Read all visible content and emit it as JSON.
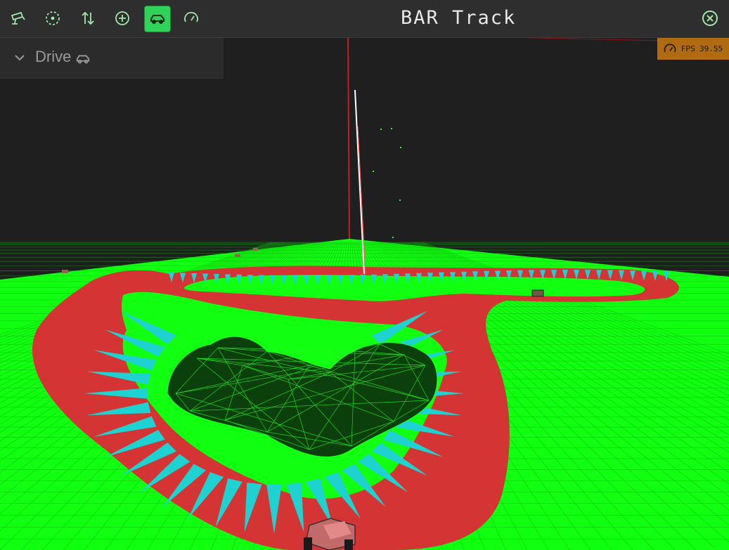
{
  "toolbar": {
    "title": "BAR Track",
    "tools": [
      "camera-icon",
      "target-icon",
      "sort-arrows-icon",
      "add-icon",
      "car-icon",
      "gauge-icon"
    ],
    "active_tool": "car-icon",
    "close_icon": "close-icon"
  },
  "panel": {
    "label": "Drive",
    "chevron_icon": "chevron-down-icon",
    "car_icon": "car-icon"
  },
  "fps": {
    "label": "FPS",
    "value": "39.55",
    "icon": "gauge-icon"
  },
  "colors": {
    "terrain": "#11ff11",
    "track_red": "#d43434",
    "track_cyan": "#1fd2d2",
    "sky": "#1f1f1f",
    "accent": "#2fd35a"
  }
}
